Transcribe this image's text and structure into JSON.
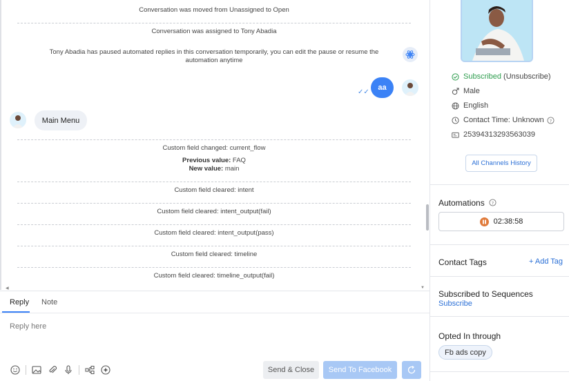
{
  "messages": {
    "events": [
      "Conversation was moved from Unassigned to Open",
      "Conversation was assigned to Tony Abadia",
      "Tony Abadia has paused automated replies in this conversation temporarily, you can edit the pause or resume the",
      "automation anytime"
    ],
    "outgoing_bubble": "aa",
    "incoming_bubble": "Main Menu",
    "field_changed": "Custom field changed: current_flow",
    "previous_label": "Previous value:",
    "previous_value": "FAQ",
    "new_label": "New value:",
    "new_value": "main",
    "cleared": [
      "Custom field cleared: intent",
      "Custom field cleared: intent_output(fail)",
      "Custom field cleared: intent_output(pass)",
      "Custom field cleared: timeline",
      "Custom field cleared: timeline_output(fail)"
    ]
  },
  "reply": {
    "tabs": [
      "Reply",
      "Note"
    ],
    "placeholder": "Reply here",
    "send_close": "Send & Close",
    "send_facebook": "Send To Facebook"
  },
  "panel": {
    "subscribed": "Subscribed",
    "unsubscribe": "(Unsubscribe)",
    "gender": "Male",
    "language": "English",
    "contact_time": "Contact Time: Unknown",
    "user_id": "25394313293563039",
    "history_button": "All Channels History",
    "automations_title": "Automations",
    "timer": "02:38:58",
    "tags_title": "Contact Tags",
    "add_tag": "+ Add Tag",
    "sequences_title": "Subscribed to Sequences",
    "subscribe_link": "Subscribe",
    "opted_title": "Opted In through",
    "opted_chip": "Fb ads copy"
  },
  "colors": {
    "accent": "#3b82f6",
    "subscribed_green": "#2e9d4e",
    "timer_orange": "#e07a3a"
  },
  "icons": [
    "bot-icon",
    "check-icon",
    "emoji-icon",
    "image-icon",
    "attach-icon",
    "mic-icon",
    "flow-icon",
    "ai-icon",
    "refresh-icon",
    "info-icon",
    "pause-icon"
  ]
}
